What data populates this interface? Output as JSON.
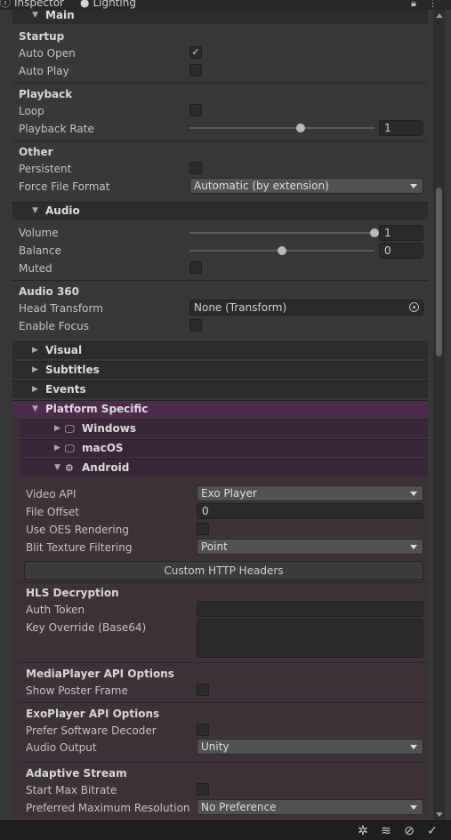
{
  "tabs": [
    {
      "label": "Inspector",
      "icon": "info-icon"
    },
    {
      "label": "Lighting",
      "icon": "bulb-icon"
    }
  ],
  "sections": {
    "main": {
      "label": "Main"
    },
    "audio": {
      "label": "Audio"
    },
    "visual": {
      "label": "Visual"
    },
    "subtitles": {
      "label": "Subtitles"
    },
    "events": {
      "label": "Events"
    },
    "platform": {
      "label": "Platform Specific"
    },
    "windows": {
      "label": "Windows"
    },
    "macos": {
      "label": "macOS"
    },
    "android": {
      "label": "Android"
    }
  },
  "main": {
    "startup": {
      "title": "Startup",
      "auto_open": "Auto Open",
      "auto_play": "Auto Play",
      "auto_open_checked": true,
      "auto_play_checked": false
    },
    "playback": {
      "title": "Playback",
      "loop": "Loop",
      "rate_label": "Playback Rate",
      "rate_value": "1",
      "rate_fraction": 0.6
    },
    "other": {
      "title": "Other",
      "persistent": "Persistent",
      "format_label": "Force File Format",
      "format_value": "Automatic (by extension)"
    }
  },
  "audio": {
    "volume_label": "Volume",
    "volume_value": "1",
    "volume_fraction": 1.0,
    "balance_label": "Balance",
    "balance_value": "0",
    "balance_fraction": 0.5,
    "muted_label": "Muted",
    "audio360_title": "Audio 360",
    "head_label": "Head Transform",
    "head_value": "None (Transform)",
    "focus_label": "Enable Focus"
  },
  "android": {
    "video_api_label": "Video API",
    "video_api_value": "Exo Player",
    "file_offset_label": "File Offset",
    "file_offset_value": "0",
    "oes_label": "Use OES Rendering",
    "blit_label": "Blit Texture Filtering",
    "blit_value": "Point",
    "http_button": "Custom HTTP Headers",
    "hls_title": "HLS Decryption",
    "auth_label": "Auth Token",
    "auth_value": "",
    "key_label": "Key Override (Base64)",
    "mp_title": "MediaPlayer API Options",
    "poster_label": "Show Poster Frame",
    "exo_title": "ExoPlayer API Options",
    "software_label": "Prefer Software Decoder",
    "audio_output_label": "Audio Output",
    "audio_output_value": "Unity",
    "adaptive_title": "Adaptive Stream",
    "max_bitrate_label": "Start Max Bitrate",
    "pref_res_label": "Preferred Maximum Resolution",
    "pref_res_value": "No Preference"
  },
  "colors": {
    "platform_header": "#4d2a4e",
    "sub_header": "#3a2639",
    "panel": "#383838"
  }
}
